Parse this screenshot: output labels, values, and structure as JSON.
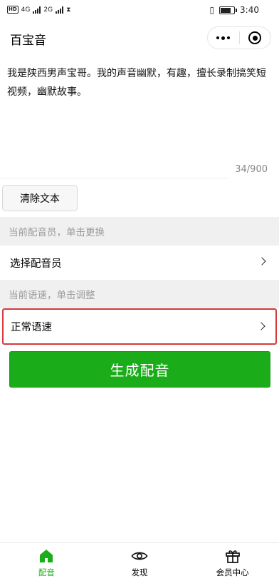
{
  "status_bar": {
    "network_hd": "HD",
    "network_1": "4G",
    "network_2": "2G",
    "time": "3:40"
  },
  "nav": {
    "title": "百宝音",
    "more_icon": "more-dots-icon",
    "close_icon": "close-target-icon"
  },
  "editor": {
    "text": "我是陕西男声宝哥。我的声音幽默，有趣，擅长录制搞笑短视频，幽默故事。",
    "counter": "34/900"
  },
  "clear_button": {
    "label": "清除文本"
  },
  "voice_section": {
    "header": "当前配音员，单击更换",
    "current": "选择配音员"
  },
  "speed_section": {
    "header": "当前语速，单击调整",
    "current": "正常语速"
  },
  "generate_button": {
    "label": "生成配音"
  },
  "tabs": [
    {
      "label": "配音",
      "icon": "home-icon",
      "active": true
    },
    {
      "label": "发现",
      "icon": "eye-icon",
      "active": false
    },
    {
      "label": "会员中心",
      "icon": "gift-icon",
      "active": false
    }
  ],
  "colors": {
    "accent_green": "#1aad19",
    "highlight_red": "#d63a3a",
    "section_gray": "#f0f0f0"
  }
}
